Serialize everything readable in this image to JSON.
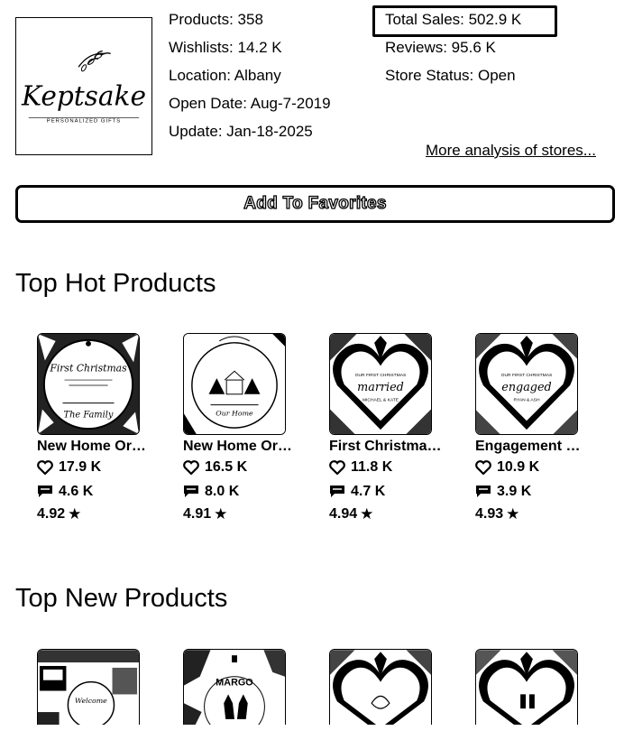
{
  "store": {
    "logo_text": "Keptsake",
    "logo_subtext": "PERSONALIZED GIFTS",
    "products": "Products: 358",
    "wishlists": "Wishlists: 14.2 K",
    "location": "Location: Albany",
    "open_date": "Open Date: Aug-7-2019",
    "update": "Update: Jan-18-2025",
    "total_sales": "Total Sales: 502.9 K",
    "reviews": "Reviews: 95.6 K",
    "status": "Store Status: Open",
    "more_link": "More analysis of stores..."
  },
  "favorites_button": "Add To Favorites",
  "hot_section": {
    "title": "Top Hot Products",
    "products": [
      {
        "name": "New Home Ornament",
        "likes": "17.9 K",
        "reviews": "4.6 K",
        "rating": "4.92"
      },
      {
        "name": "New Home Ornament",
        "likes": "16.5 K",
        "reviews": "8.0 K",
        "rating": "4.91"
      },
      {
        "name": "First Christmas Married",
        "likes": "11.8 K",
        "reviews": "4.7 K",
        "rating": "4.94"
      },
      {
        "name": "Engagement Christmas",
        "likes": "10.9 K",
        "reviews": "3.9 K",
        "rating": "4.93"
      }
    ]
  },
  "new_section": {
    "title": "Top New Products"
  },
  "icons": {
    "heart": "heart-icon",
    "comment": "comment-icon",
    "star": "★"
  }
}
